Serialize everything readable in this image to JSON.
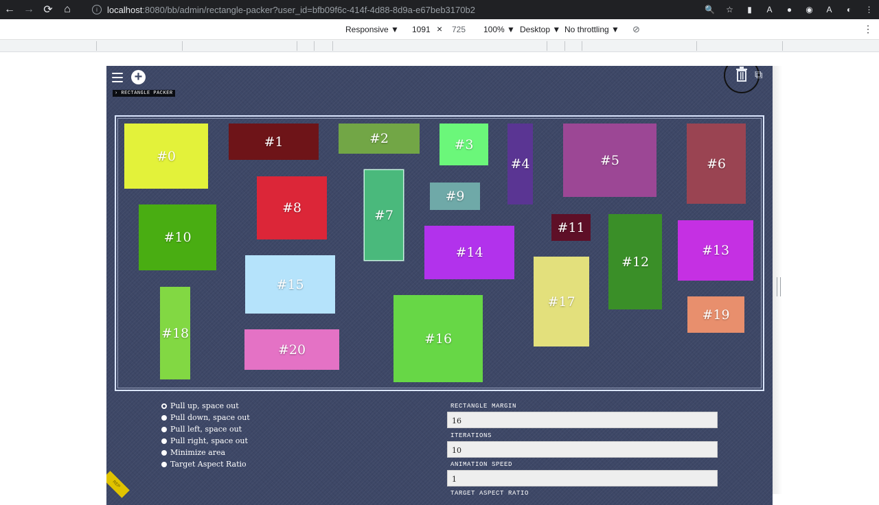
{
  "browser": {
    "url_host": "localhost",
    "url_rest": ":8080/bb/admin/rectangle-packer?user_id=bfb09f6c-414f-4d88-8d9a-e67beb3170b2",
    "info_glyph": "i",
    "nav": {
      "back": "←",
      "forward": "→",
      "reload": "⟳",
      "home": "⌂"
    },
    "ext_icons": [
      "🔍",
      "☆",
      "▮",
      "A",
      "●",
      "◉",
      "A",
      "◐",
      "⋮"
    ]
  },
  "devtools": {
    "device": "Responsive ▼",
    "width": "1091",
    "times": "×",
    "height": "725",
    "zoom": "100% ▼",
    "mode": "Desktop ▼",
    "throttle": "No throttling ▼",
    "rotate_glyph": "⊘",
    "more_glyph": "⋮"
  },
  "app": {
    "title": "› RECTANGLE PACKER",
    "add_glyph": "+",
    "copy_glyph": "⧉",
    "ribbon_text": "REP"
  },
  "rectangles": [
    {
      "label": "#0",
      "color": "#e3f23a"
    },
    {
      "label": "#1",
      "color": "#6e1418"
    },
    {
      "label": "#2",
      "color": "#72a646"
    },
    {
      "label": "#3",
      "color": "#6bf77a"
    },
    {
      "label": "#4",
      "color": "#5a3593"
    },
    {
      "label": "#5",
      "color": "#9c4795"
    },
    {
      "label": "#6",
      "color": "#9a4452"
    },
    {
      "label": "#7",
      "color": "#4ab97c"
    },
    {
      "label": "#8",
      "color": "#dc2638"
    },
    {
      "label": "#9",
      "color": "#6fa9a8"
    },
    {
      "label": "#10",
      "color": "#49ad12"
    },
    {
      "label": "#11",
      "color": "#5e0f27"
    },
    {
      "label": "#12",
      "color": "#3a8f28"
    },
    {
      "label": "#13",
      "color": "#c530e3"
    },
    {
      "label": "#14",
      "color": "#b232ec"
    },
    {
      "label": "#15",
      "color": "#b5e3fb"
    },
    {
      "label": "#16",
      "color": "#67d746"
    },
    {
      "label": "#17",
      "color": "#e3e07c"
    },
    {
      "label": "#18",
      "color": "#82d843"
    },
    {
      "label": "#19",
      "color": "#e88f6d"
    },
    {
      "label": "#20",
      "color": "#e472c5"
    }
  ],
  "options": [
    {
      "label": "Pull up, space out",
      "selected": true
    },
    {
      "label": "Pull down, space out",
      "selected": false
    },
    {
      "label": "Pull left, space out",
      "selected": false
    },
    {
      "label": "Pull right, space out",
      "selected": false
    },
    {
      "label": "Minimize area",
      "selected": false
    },
    {
      "label": "Target Aspect Ratio",
      "selected": false
    }
  ],
  "fields": [
    {
      "label": "RECTANGLE MARGIN",
      "value": "16"
    },
    {
      "label": "ITERATIONS",
      "value": "10"
    },
    {
      "label": "ANIMATION SPEED",
      "value": "1"
    },
    {
      "label": "TARGET ASPECT RATIO",
      "value": ""
    }
  ]
}
